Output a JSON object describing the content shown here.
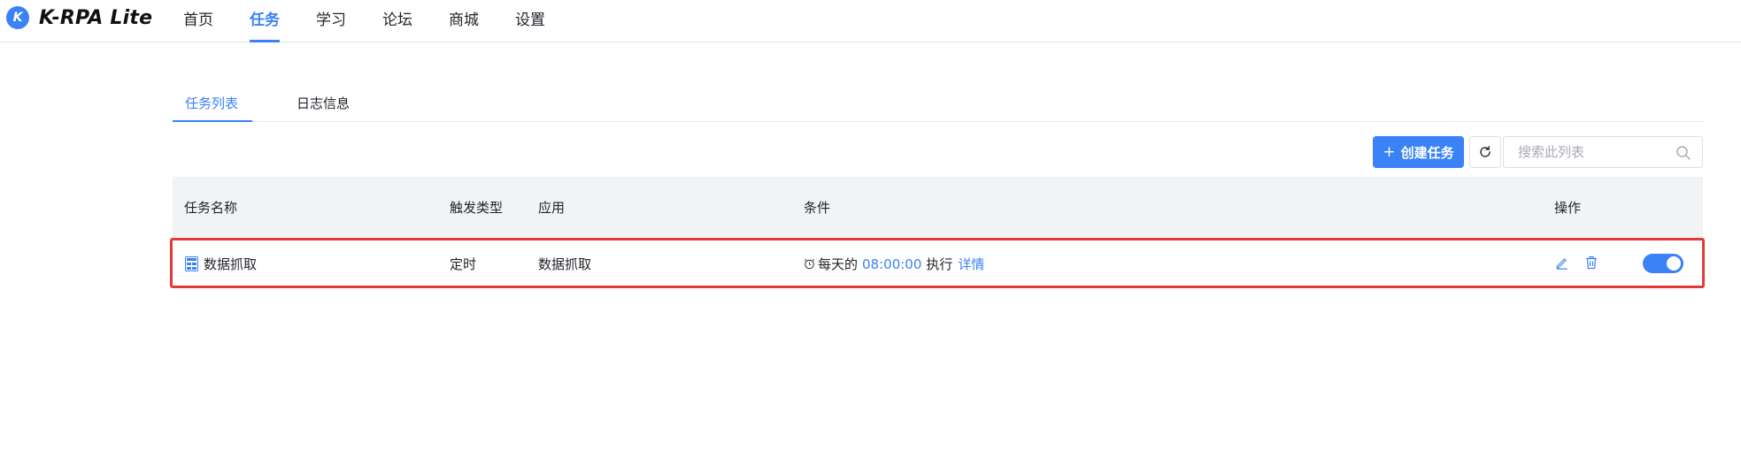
{
  "app": {
    "logo_letter": "K",
    "name": "K-RPA Lite"
  },
  "nav": {
    "items": [
      {
        "label": "首页"
      },
      {
        "label": "任务"
      },
      {
        "label": "学习"
      },
      {
        "label": "论坛"
      },
      {
        "label": "商城"
      },
      {
        "label": "设置"
      }
    ],
    "active": "任务"
  },
  "subtabs": {
    "items": [
      {
        "label": "任务列表"
      },
      {
        "label": "日志信息"
      }
    ],
    "active": "任务列表"
  },
  "toolbar": {
    "create_label": "创建任务",
    "create_icon": "plus-icon",
    "refresh_icon": "refresh-icon",
    "search_placeholder": "搜索此列表",
    "search_icon": "search-icon"
  },
  "table": {
    "columns": {
      "name": "任务名称",
      "trigger": "触发类型",
      "app": "应用",
      "condition": "条件",
      "actions": "操作"
    },
    "rows": [
      {
        "icon": "task-table-icon",
        "name": "数据抓取",
        "trigger": "定时",
        "app": "数据抓取",
        "condition_icon": "alarm-clock-icon",
        "condition_prefix": "每天的",
        "condition_time": "08:00:00",
        "condition_suffix": "执行",
        "condition_link": "详情",
        "enabled": true
      }
    ]
  },
  "colors": {
    "accent": "#3b82f6",
    "highlight": "#e53935",
    "header_bg": "#f2f3f5"
  }
}
